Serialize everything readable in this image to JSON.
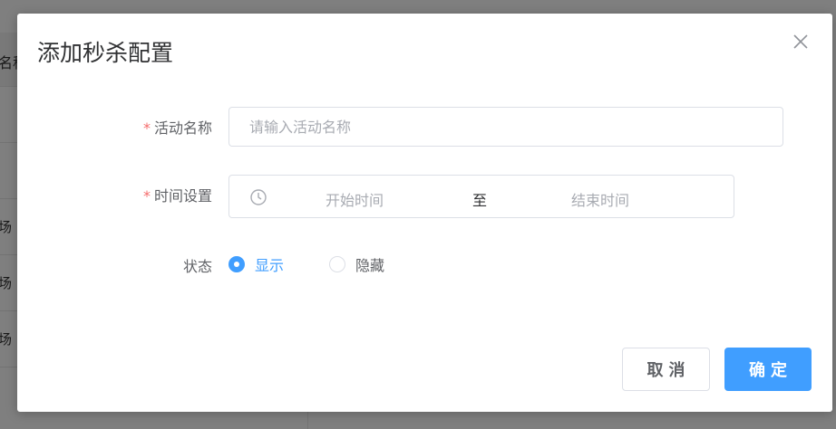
{
  "background": {
    "header_text": "名称",
    "row_texts": [
      "场",
      "场",
      "场"
    ]
  },
  "dialog": {
    "title": "添加秒杀配置",
    "close_icon": "close-icon"
  },
  "form": {
    "activity_name": {
      "label": "活动名称",
      "required_mark": "*",
      "value": "",
      "placeholder": "请输入活动名称"
    },
    "time_setting": {
      "label": "时间设置",
      "required_mark": "*",
      "icon": "clock-icon",
      "start_placeholder": "开始时间",
      "separator": "至",
      "end_placeholder": "结束时间"
    },
    "status": {
      "label": "状态",
      "options": [
        {
          "label": "显示",
          "checked": true
        },
        {
          "label": "隐藏",
          "checked": false
        }
      ]
    }
  },
  "footer": {
    "cancel_label": "取消",
    "confirm_label": "确定"
  },
  "colors": {
    "primary": "#409eff",
    "required": "#f56c6c"
  }
}
